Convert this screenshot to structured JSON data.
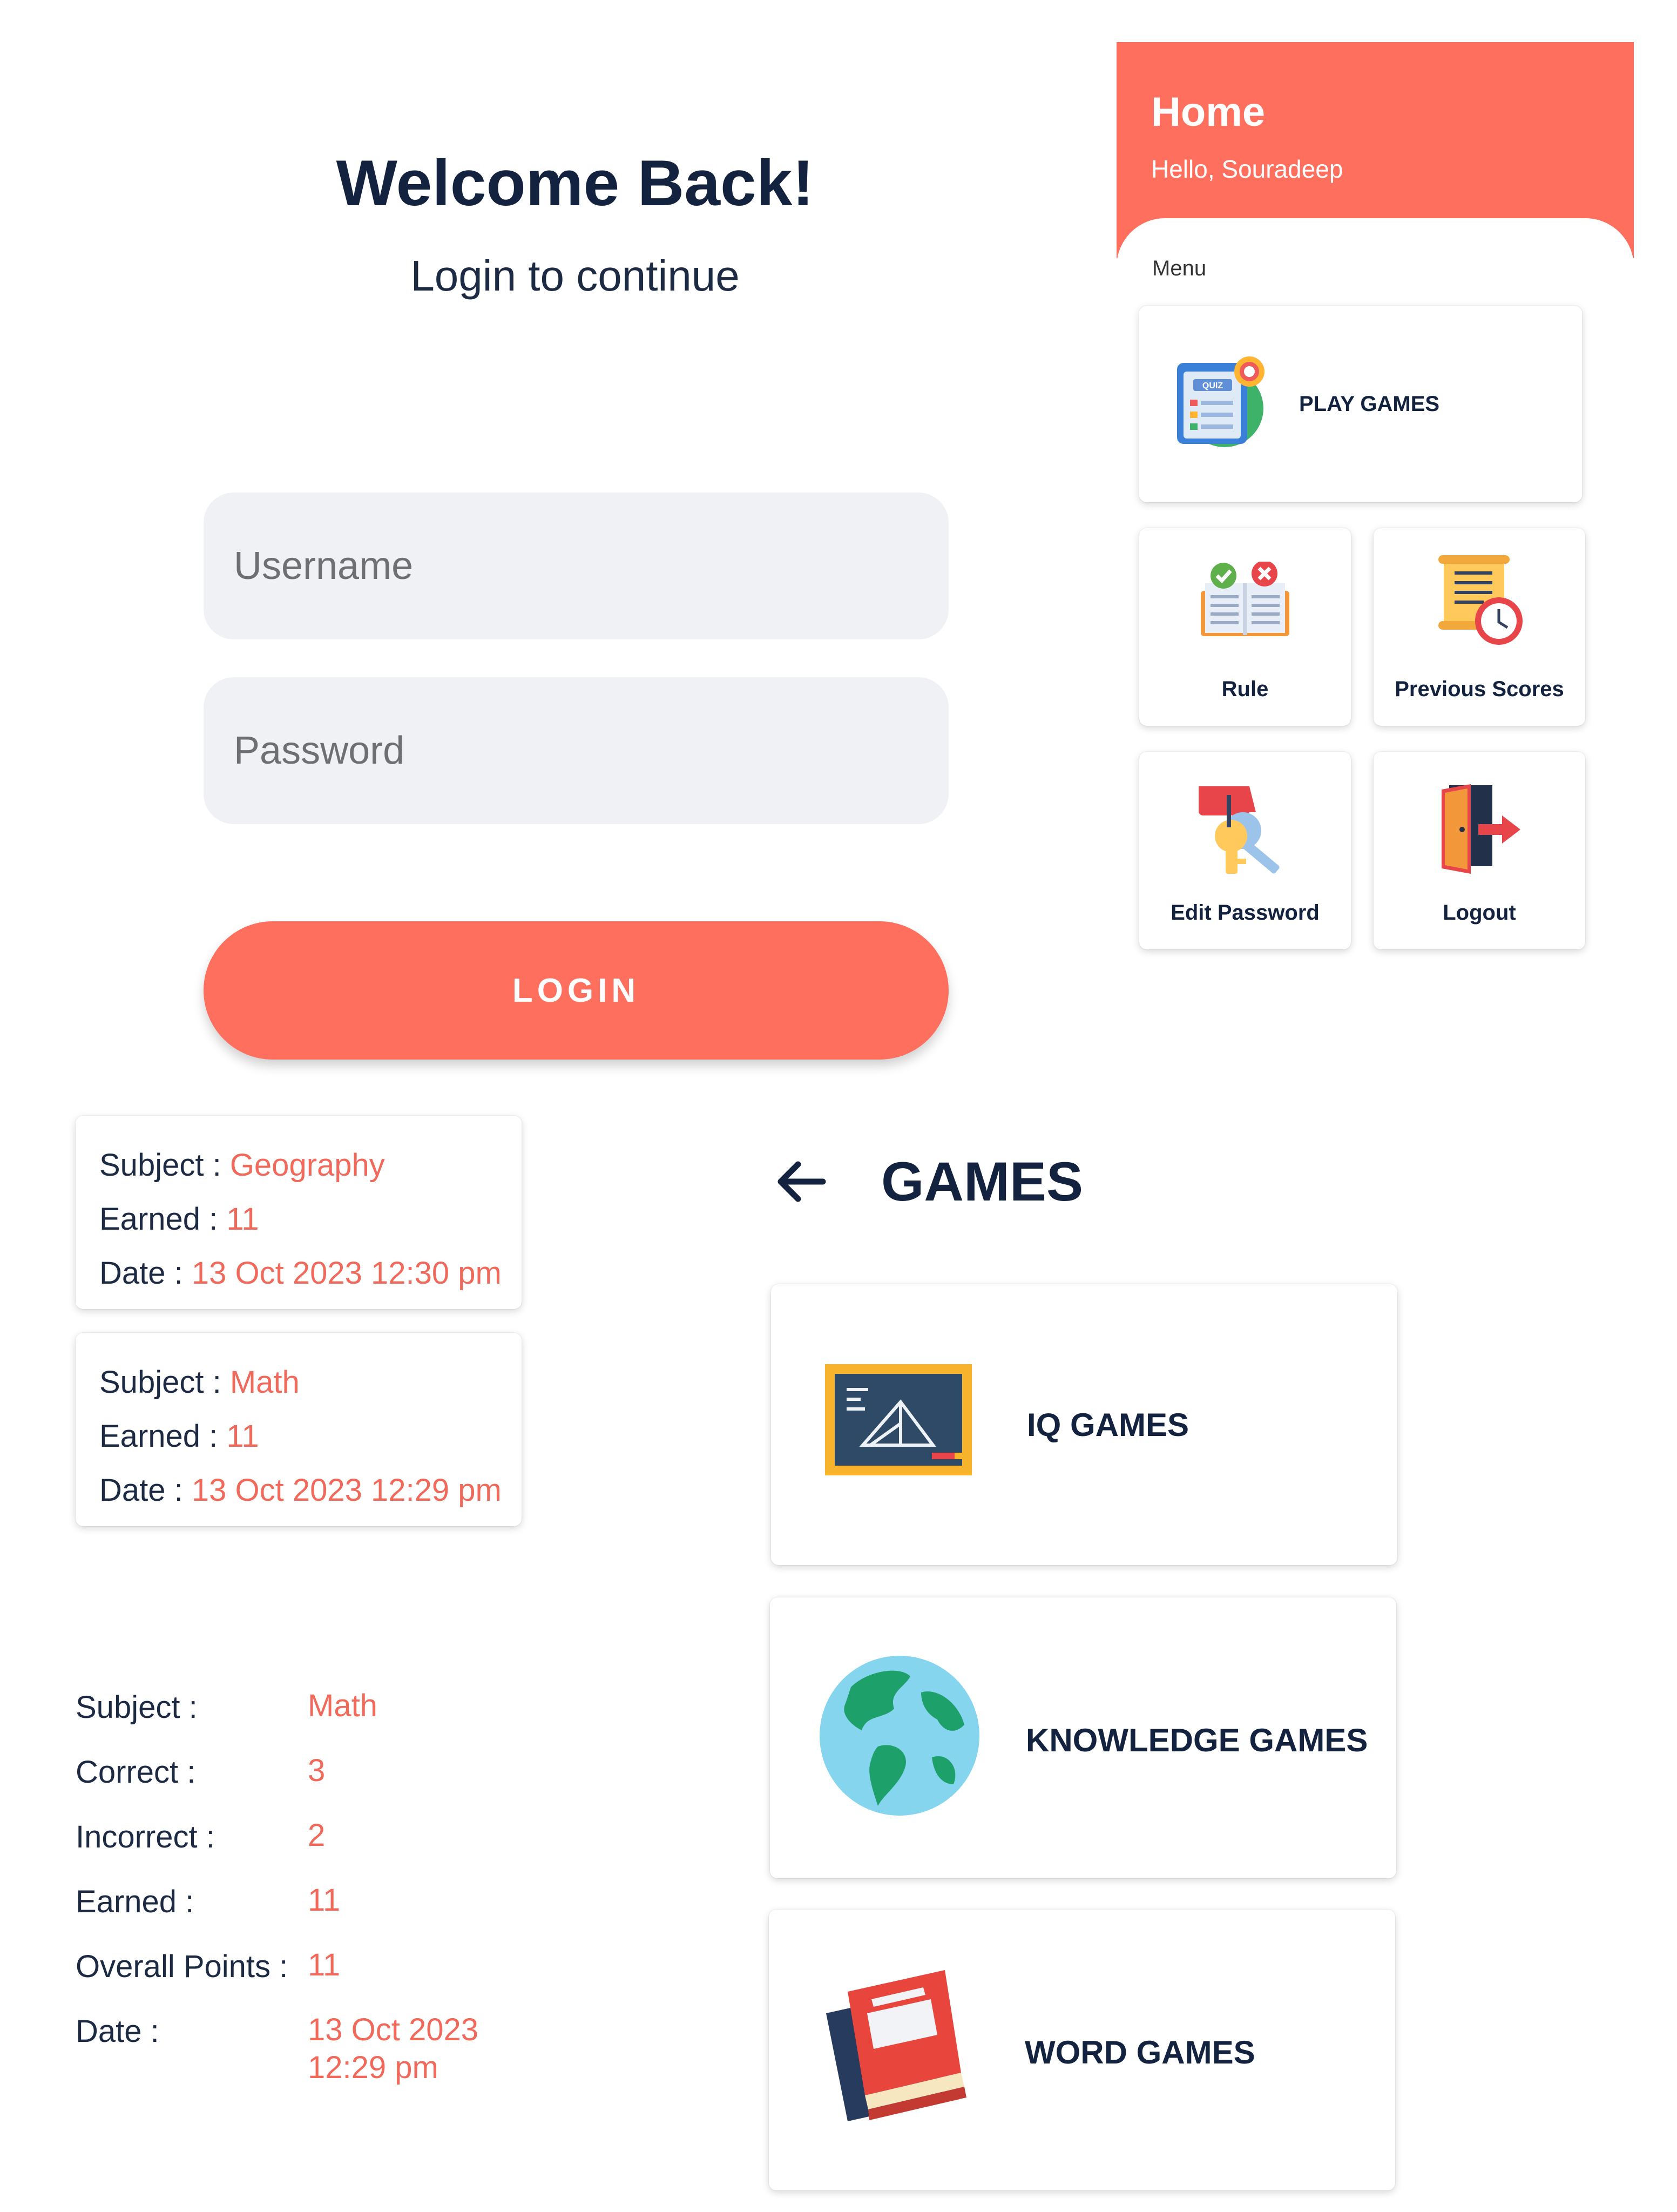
{
  "login": {
    "title": "Welcome Back!",
    "subtitle": "Login to continue",
    "username_placeholder": "Username",
    "password_placeholder": "Password",
    "login_button": "LOGIN"
  },
  "home": {
    "title": "Home",
    "greeting": "Hello, Souradeep",
    "menu_label": "Menu",
    "play_games": "PLAY GAMES",
    "rule": "Rule",
    "previous_scores": "Previous Scores",
    "edit_password": "Edit Password",
    "logout": "Logout"
  },
  "previous_scores": [
    {
      "subject_label": "Subject :",
      "subject": "Geography",
      "earned_label": "Earned :",
      "earned": "11",
      "date_label": "Date :",
      "date": "13 Oct 2023 12:30 pm"
    },
    {
      "subject_label": "Subject :",
      "subject": "Math",
      "earned_label": "Earned :",
      "earned": "11",
      "date_label": "Date :",
      "date": "13 Oct 2023 12:29 pm"
    }
  ],
  "result": {
    "subject_label": "Subject :",
    "subject": "Math",
    "correct_label": "Correct :",
    "correct": "3",
    "incorrect_label": "Incorrect :",
    "incorrect": "2",
    "earned_label": "Earned :",
    "earned": "11",
    "overall_label": "Overall Points :",
    "overall": "11",
    "date_label": "Date :",
    "date_line1": "13 Oct 2023",
    "date_line2": "12:29 pm"
  },
  "games": {
    "title": "GAMES",
    "back_icon": "arrow-left-icon",
    "items": [
      {
        "label": "IQ GAMES",
        "icon": "chalkboard-icon"
      },
      {
        "label": "KNOWLEDGE GAMES",
        "icon": "globe-icon"
      },
      {
        "label": "WORD GAMES",
        "icon": "books-icon"
      }
    ]
  },
  "colors": {
    "accent": "#ff6f5e",
    "navy": "#13233f",
    "field_bg": "#f0f1f4"
  }
}
